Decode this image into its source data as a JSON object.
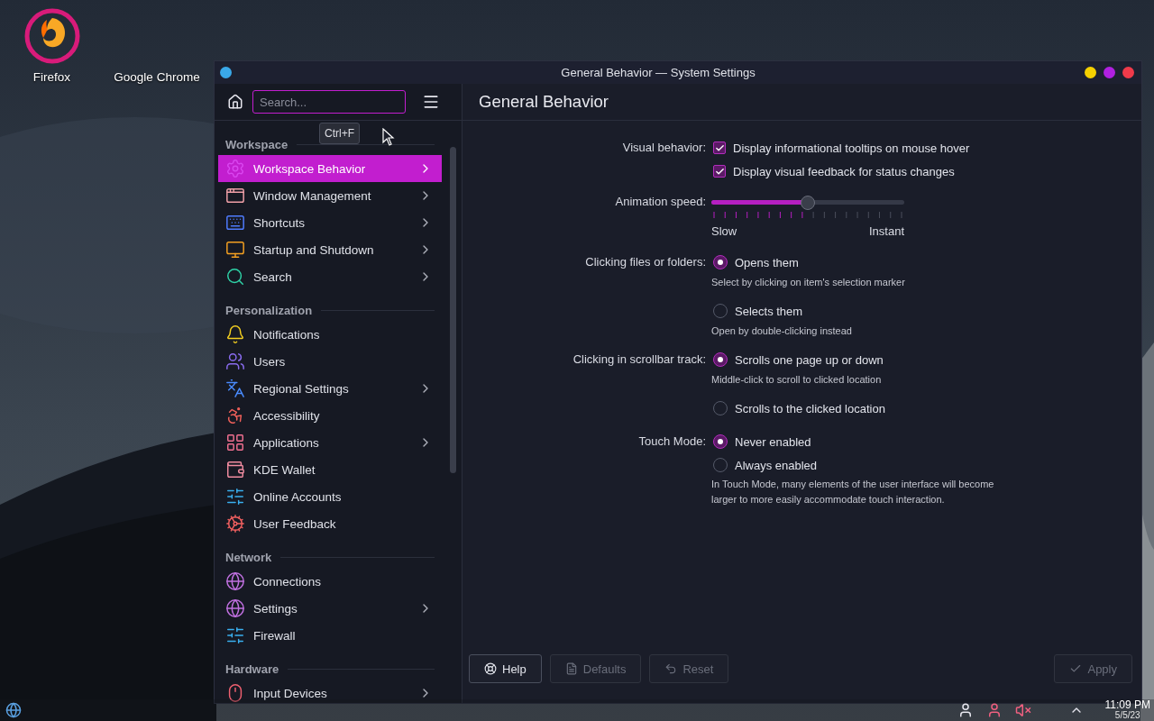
{
  "desktop_icons": [
    {
      "label": "Firefox",
      "kind": "firefox"
    },
    {
      "label": "Google Chrome",
      "kind": "label"
    }
  ],
  "window": {
    "title": "General Behavior — System Settings"
  },
  "sidebar": {
    "search": {
      "placeholder": "Search..."
    },
    "tooltip": "Ctrl+F",
    "sections": [
      {
        "title": "Workspace",
        "items": [
          {
            "label": "Workspace Behavior",
            "arrow": true,
            "selected": true
          },
          {
            "label": "Window Management",
            "arrow": true,
            "selected": false
          },
          {
            "label": "Shortcuts",
            "arrow": true,
            "selected": false
          },
          {
            "label": "Startup and Shutdown",
            "arrow": true,
            "selected": false
          },
          {
            "label": "Search",
            "arrow": true,
            "selected": false
          }
        ]
      },
      {
        "title": "Personalization",
        "items": [
          {
            "label": "Notifications",
            "arrow": false,
            "selected": false
          },
          {
            "label": "Users",
            "arrow": false,
            "selected": false
          },
          {
            "label": "Regional Settings",
            "arrow": true,
            "selected": false
          },
          {
            "label": "Accessibility",
            "arrow": false,
            "selected": false
          },
          {
            "label": "Applications",
            "arrow": true,
            "selected": false
          },
          {
            "label": "KDE Wallet",
            "arrow": false,
            "selected": false
          },
          {
            "label": "Online Accounts",
            "arrow": false,
            "selected": false
          },
          {
            "label": "User Feedback",
            "arrow": false,
            "selected": false
          }
        ]
      },
      {
        "title": "Network",
        "items": [
          {
            "label": "Connections",
            "arrow": false,
            "selected": false
          },
          {
            "label": "Settings",
            "arrow": true,
            "selected": false
          },
          {
            "label": "Firewall",
            "arrow": false,
            "selected": false
          }
        ]
      },
      {
        "title": "Hardware",
        "items": [
          {
            "label": "Input Devices",
            "arrow": true,
            "selected": false
          }
        ]
      }
    ]
  },
  "page": {
    "title": "General Behavior",
    "settings": [
      {
        "kind": "checkboxes",
        "label": "Visual behavior:",
        "options": [
          {
            "label": "Display informational tooltips on mouse hover",
            "checked": true
          },
          {
            "label": "Display visual feedback for status changes",
            "checked": true
          }
        ]
      },
      {
        "kind": "slider",
        "label": "Animation speed:",
        "level": 0.5,
        "min_label": "Slow",
        "max_label": "Instant"
      },
      {
        "kind": "radios",
        "label": "Clicking files or folders:",
        "options": [
          {
            "label": "Opens them",
            "hint": "Select by clicking on item's selection marker",
            "selected": true
          },
          {
            "label": "Selects them",
            "hint": "Open by double-clicking instead",
            "selected": false
          }
        ]
      },
      {
        "kind": "radios",
        "label": "Clicking in scrollbar track:",
        "options": [
          {
            "label": "Scrolls one page up or down",
            "hint": "Middle-click to scroll to clicked location",
            "selected": true
          },
          {
            "label": "Scrolls to the clicked location",
            "selected": false
          }
        ]
      },
      {
        "kind": "radios",
        "label": "Touch Mode:",
        "options": [
          {
            "label": "Never enabled",
            "selected": true
          },
          {
            "label": "Always enabled",
            "selected": false
          }
        ],
        "note": "In Touch Mode, many elements of the user interface will become larger to more easily accommodate touch interaction."
      }
    ]
  },
  "buttons": [
    {
      "label": "Help",
      "kind": "help",
      "disabled": false
    },
    {
      "label": "Defaults",
      "kind": "defaults",
      "disabled": true
    },
    {
      "label": "Reset",
      "kind": "reset",
      "disabled": true
    },
    {
      "label": "Apply",
      "kind": "apply",
      "disabled": true
    }
  ],
  "taskbar": {
    "time": "11:09 PM",
    "date": "5/5/23"
  }
}
